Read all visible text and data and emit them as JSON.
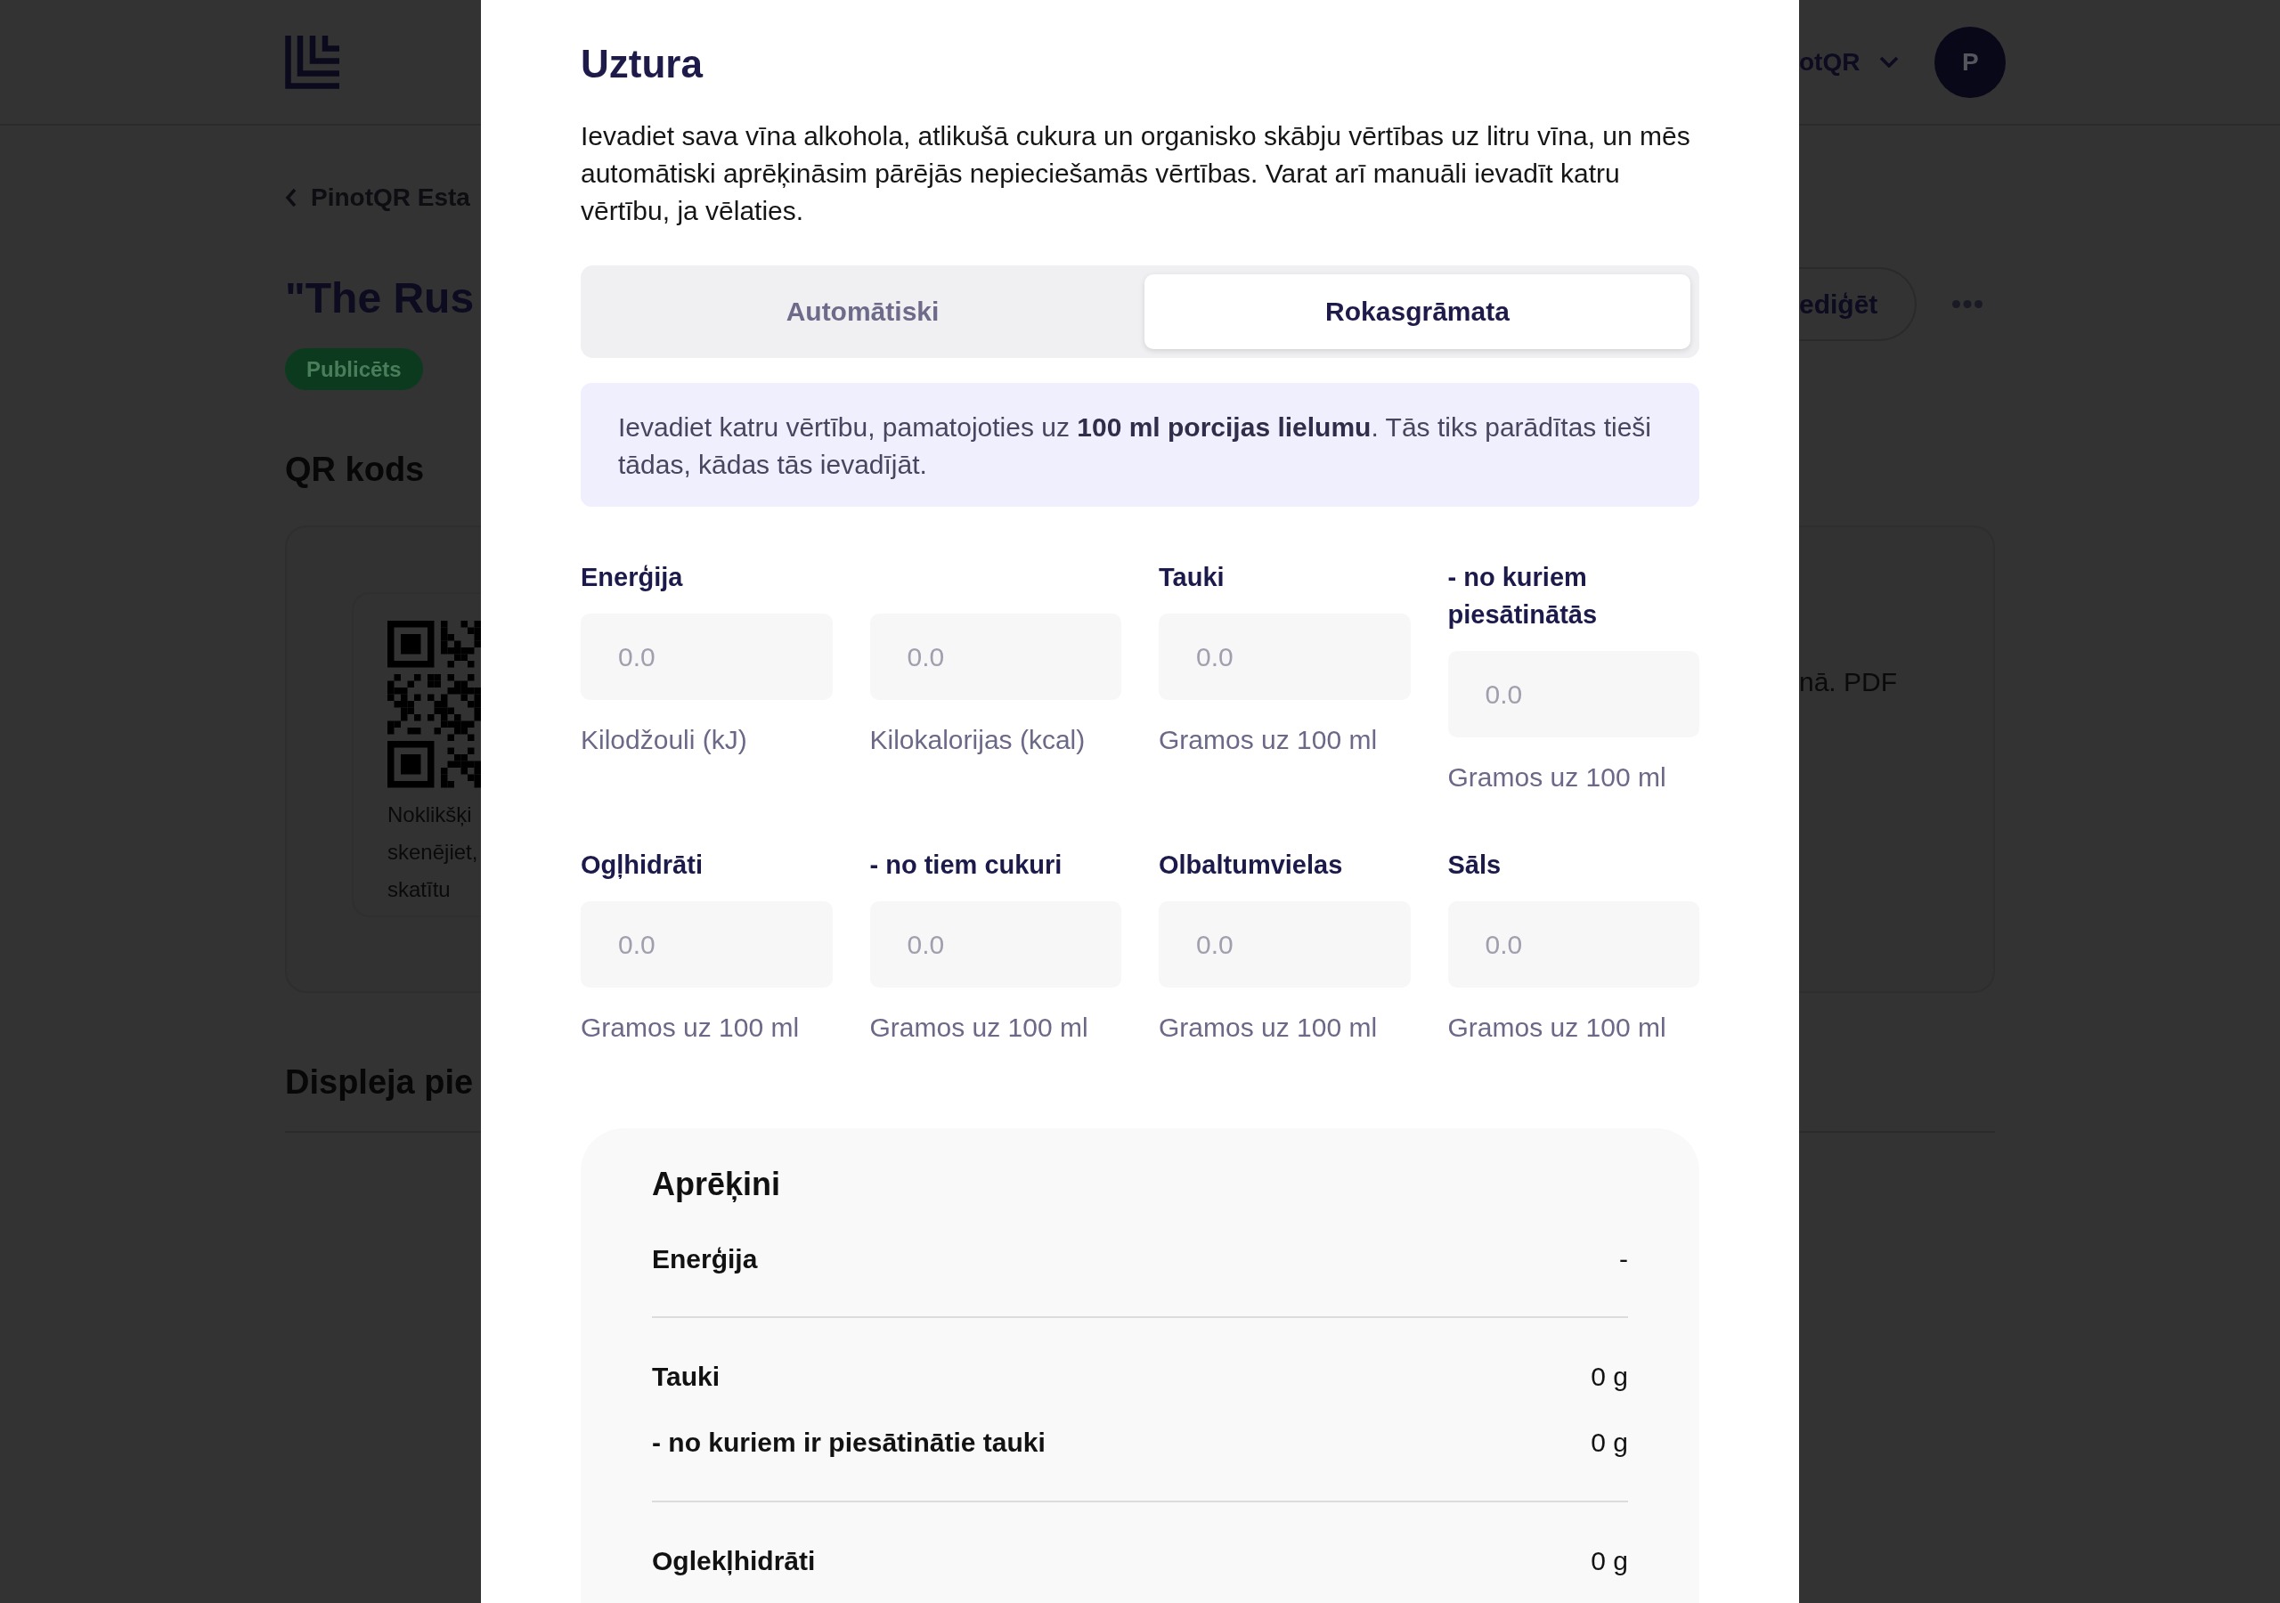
{
  "page": {
    "header": {
      "account_name": "otQR",
      "avatar_initial": "P"
    },
    "back_link": "PinotQR Esta",
    "title": "\"The Rus",
    "status_badge": "Publicēts",
    "edit_button": "ediģēt",
    "qr_section": {
      "heading": "QR kods",
      "caption_lines": [
        "Noklikšķi",
        "skenējiet,",
        "skatītu"
      ],
      "side_text": "nā. PDF"
    },
    "display_section": {
      "heading": "Displeja pie"
    }
  },
  "modal": {
    "title": "Uztura",
    "description": "Ievadiet sava vīna alkohola, atlikušā cukura un organisko skābju vērtības uz litru vīna, un mēs automātiski aprēķināsim pārējās nepieciešamās vērtības. Varat arī manuāli ievadīt katru vērtību, ja vēlaties.",
    "tabs": [
      {
        "label": "Automātiski",
        "selected": false
      },
      {
        "label": "Rokasgrāmata",
        "selected": true
      }
    ],
    "info": "Ievadiet katru vērtību, pamatojoties uz **100 ml porcijas lielumu**. Tās tiks parādītas tieši tādas, kādas tās ievadījāt.",
    "fields": [
      {
        "label": "Enerģija",
        "placeholder": "0.0",
        "hint": "Kilodžouli (kJ)"
      },
      {
        "placeholder": "0.0",
        "hint": "Kilokalorijas (kcal)"
      },
      {
        "label": "Tauki",
        "placeholder": "0.0",
        "hint": "Gramos uz 100 ml"
      },
      {
        "label": "- no kuriem piesātinātās",
        "placeholder": "0.0",
        "hint": "Gramos uz 100 ml"
      },
      {
        "label": "Ogļhidrāti",
        "placeholder": "0.0",
        "hint": "Gramos uz 100 ml"
      },
      {
        "label": "- no tiem cukuri",
        "placeholder": "0.0",
        "hint": "Gramos uz 100 ml"
      },
      {
        "label": "Olbaltumvielas",
        "placeholder": "0.0",
        "hint": "Gramos uz 100 ml"
      },
      {
        "label": "Sāls",
        "placeholder": "0.0",
        "hint": "Gramos uz 100 ml"
      }
    ],
    "calculations": {
      "title": "Aprēķini",
      "groups": [
        [
          {
            "label": "Enerģija",
            "value": "-"
          }
        ],
        [
          {
            "label": "Tauki",
            "value": "0 g"
          },
          {
            "label": "- no kuriem ir piesātinātie tauki",
            "value": "0 g"
          }
        ],
        [
          {
            "label": "Oglekļhidrāti",
            "value": "0 g"
          }
        ]
      ]
    }
  }
}
